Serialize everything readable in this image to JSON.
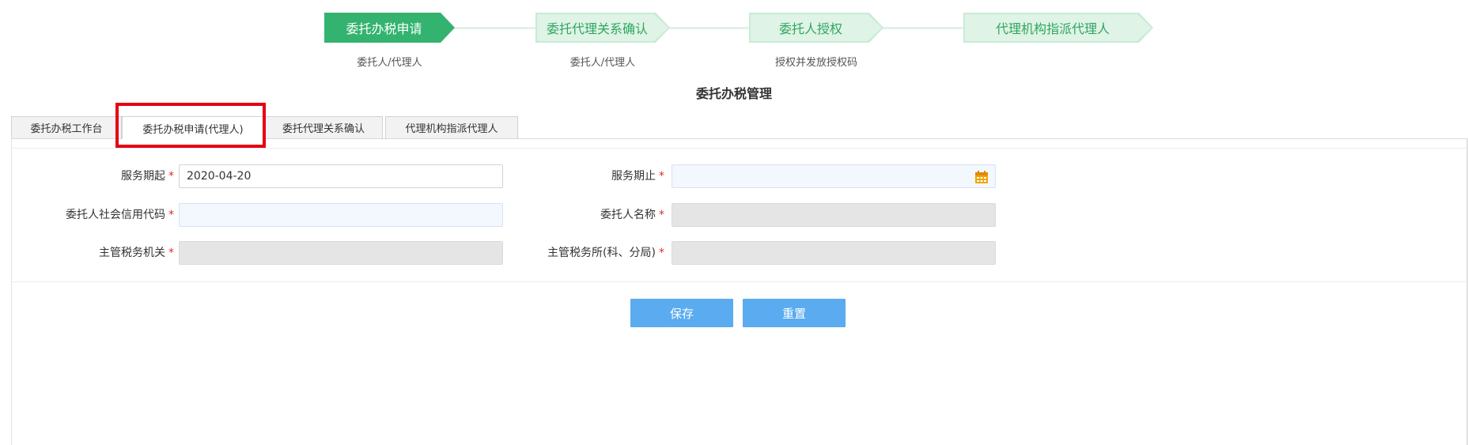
{
  "steps": [
    {
      "label": "委托办税申请",
      "sub": "委托人/代理人",
      "active": true
    },
    {
      "label": "委托代理关系确认",
      "sub": "委托人/代理人",
      "active": false
    },
    {
      "label": "委托人授权",
      "sub": "授权并发放授权码",
      "active": false
    },
    {
      "label": "代理机构指派代理人",
      "sub": "",
      "active": false
    }
  ],
  "page_title": "委托办税管理",
  "tabs": [
    {
      "label": "委托办税工作台"
    },
    {
      "label": "委托办税申请(代理人)"
    },
    {
      "label": "委托代理关系确认"
    },
    {
      "label": "代理机构指派代理人"
    }
  ],
  "active_tab": "委托办税申请(代理人)",
  "form": {
    "service_start": {
      "label": "服务期起",
      "value": "2020-04-20"
    },
    "service_end": {
      "label": "服务期止",
      "value": ""
    },
    "credit_code": {
      "label": "委托人社会信用代码",
      "value": ""
    },
    "principal_name": {
      "label": "委托人名称",
      "value": ""
    },
    "tax_authority": {
      "label": "主管税务机关",
      "value": ""
    },
    "tax_office": {
      "label": "主管税务所(科、分局)",
      "value": ""
    },
    "required_mark": "*"
  },
  "buttons": {
    "save": "保存",
    "reset": "重置"
  },
  "colors": {
    "step_active": "#33b36f",
    "step_inactive": "#dff3e6",
    "button": "#5aabef",
    "highlight": "#e60012"
  }
}
